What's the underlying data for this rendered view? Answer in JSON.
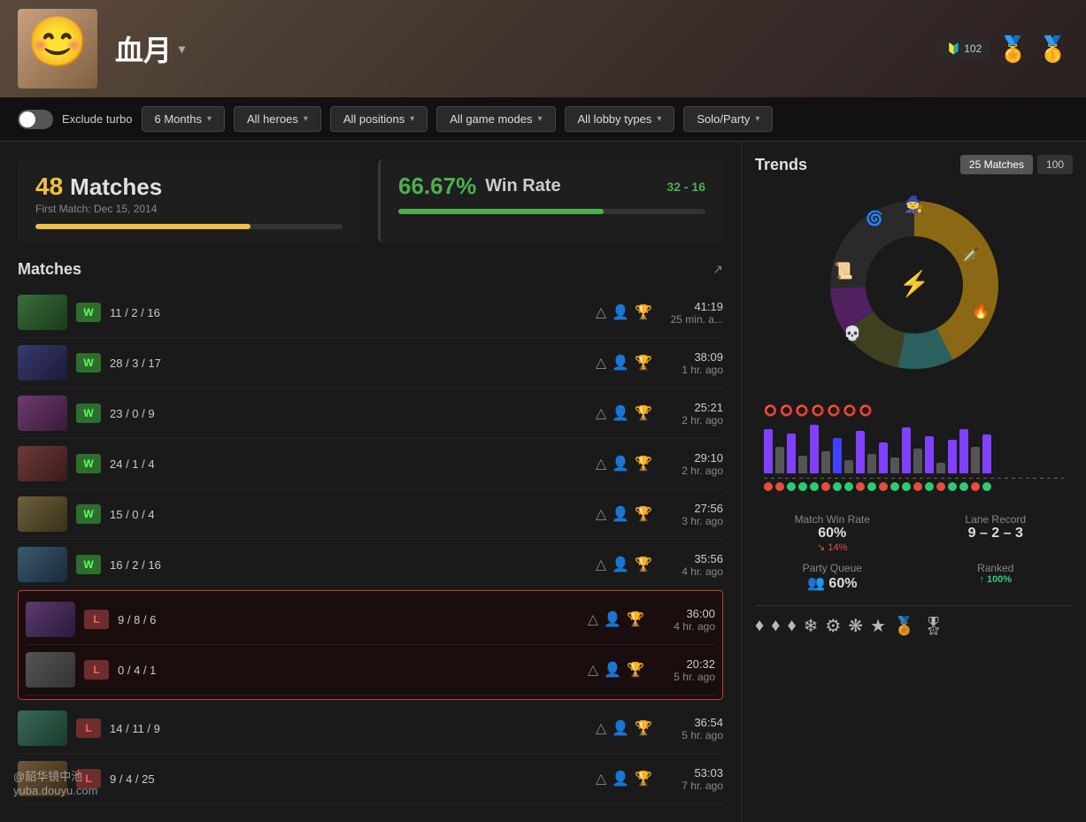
{
  "header": {
    "player_name": "血月",
    "rank_number": "102",
    "medal_emoji": "🏅"
  },
  "filters": {
    "exclude_turbo_label": "Exclude turbo",
    "period_label": "6 Months",
    "heroes_label": "All heroes",
    "positions_label": "All positions",
    "game_modes_label": "All game modes",
    "lobby_types_label": "All lobby types",
    "party_label": "Solo/Party"
  },
  "stats": {
    "matches_count": "48",
    "matches_label": "Matches",
    "first_match": "First Match: Dec 15, 2014",
    "matches_progress": 70,
    "win_rate": "66.67%",
    "win_rate_label": "Win Rate",
    "wins": "32",
    "losses": "16",
    "win_progress": 67
  },
  "trends": {
    "title": "Trends",
    "btn1": "25 Matches",
    "btn2": "100",
    "match_win_rate_label": "Match Win Rate",
    "match_win_rate_val": "60%",
    "match_win_rate_trend": "↘ 14%",
    "lane_record_label": "Lane Record",
    "lane_record_val": "9 – 2 – 3",
    "party_queue_label": "Party Queue",
    "party_queue_val": "👥 60%",
    "ranked_label": "Ranked",
    "ranked_val": "↑ 100%"
  },
  "matches": {
    "title": "Matches",
    "rows": [
      {
        "result": "W",
        "kda": "11 / 2 / 16",
        "duration": "41:19",
        "time_ago": "25 min. a...",
        "hero_class": "hero-1"
      },
      {
        "result": "W",
        "kda": "28 / 3 / 17",
        "duration": "38:09",
        "time_ago": "1 hr. ago",
        "hero_class": "hero-2"
      },
      {
        "result": "W",
        "kda": "23 / 0 / 9",
        "duration": "25:21",
        "time_ago": "2 hr. ago",
        "hero_class": "hero-3"
      },
      {
        "result": "W",
        "kda": "24 / 1 / 4",
        "duration": "29:10",
        "time_ago": "2 hr. ago",
        "hero_class": "hero-4"
      },
      {
        "result": "W",
        "kda": "15 / 0 / 4",
        "duration": "27:56",
        "time_ago": "3 hr. ago",
        "hero_class": "hero-5"
      },
      {
        "result": "W",
        "kda": "16 / 2 / 16",
        "duration": "35:56",
        "time_ago": "4 hr. ago",
        "hero_class": "hero-6"
      },
      {
        "result": "L",
        "kda": "9 / 8 / 6",
        "duration": "36:00",
        "time_ago": "4 hr. ago",
        "hero_class": "hero-7",
        "highlight": true
      },
      {
        "result": "L",
        "kda": "0 / 4 / 1",
        "duration": "20:32",
        "time_ago": "5 hr. ago",
        "hero_class": "hero-8",
        "highlight": true
      },
      {
        "result": "L",
        "kda": "14 / 11 / 9",
        "duration": "36:54",
        "time_ago": "5 hr. ago",
        "hero_class": "hero-10"
      },
      {
        "result": "L",
        "kda": "9 / 4 / 25",
        "duration": "53:03",
        "time_ago": "7 hr. ago",
        "hero_class": "hero-11"
      }
    ]
  },
  "watermark": {
    "line1": "@韶华镜中池",
    "line2": "yuba.douyu.com"
  }
}
